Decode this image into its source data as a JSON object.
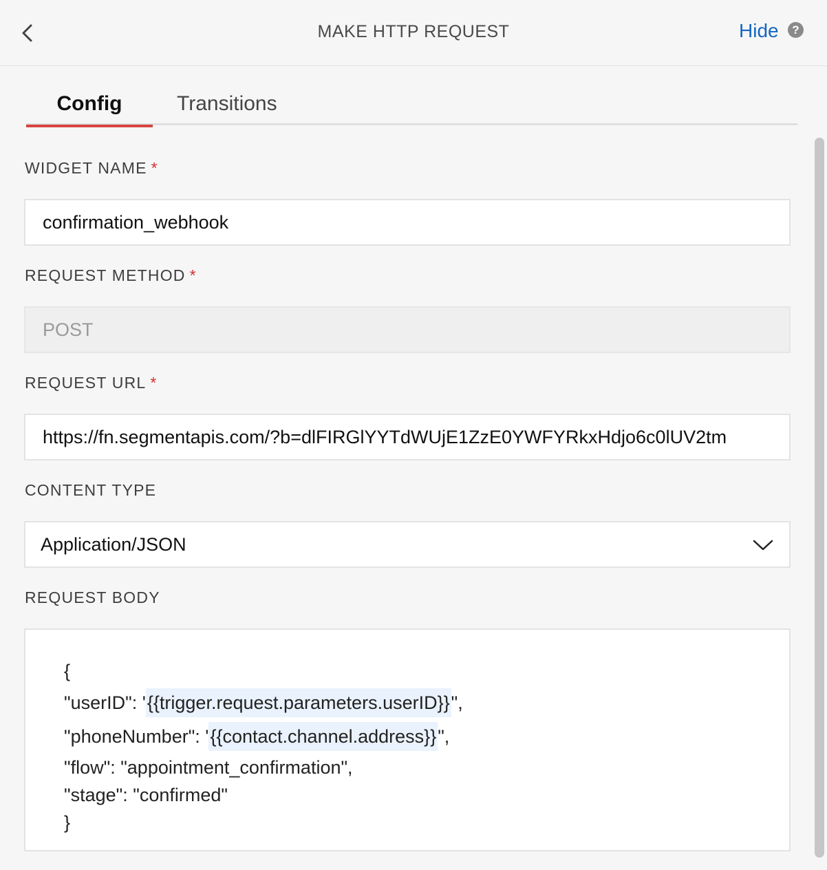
{
  "header": {
    "title": "MAKE HTTP REQUEST",
    "hide_label": "Hide",
    "help_glyph": "?"
  },
  "tabs": [
    {
      "label": "Config",
      "active": true
    },
    {
      "label": "Transitions",
      "active": false
    }
  ],
  "fields": {
    "widget_name": {
      "label": "WIDGET NAME",
      "required": "*",
      "value": "confirmation_webhook"
    },
    "request_method": {
      "label": "REQUEST METHOD",
      "required": "*",
      "value": "POST"
    },
    "request_url": {
      "label": "REQUEST URL",
      "required": "*",
      "value": "https://fn.segmentapis.com/?b=dlFIRGlYYTdWUjE1ZzE0YWFYRkxHdjo6c0lUV2tm"
    },
    "content_type": {
      "label": "CONTENT TYPE",
      "value": "Application/JSON"
    },
    "request_body": {
      "label": "REQUEST BODY",
      "lines": [
        {
          "pre": "{",
          "hl": "",
          "post": ""
        },
        {
          "pre": "\"userID\": '",
          "hl": "{{trigger.request.parameters.userID}}",
          "post": "\","
        },
        {
          "pre": "\"phoneNumber\": '",
          "hl": "{{contact.channel.address}}",
          "post": "\","
        },
        {
          "pre": "\"flow\": \"appointment_confirmation\",",
          "hl": "",
          "post": ""
        },
        {
          "pre": "\"stage\": \"confirmed\"",
          "hl": "",
          "post": ""
        },
        {
          "pre": "}",
          "hl": "",
          "post": ""
        }
      ]
    }
  },
  "colors": {
    "accent_tab": "#d64541",
    "link": "#1565c0",
    "required": "#d32f2f",
    "template_highlight": "#e9f2fd"
  },
  "icons": {
    "back": "chevron-left-icon",
    "help": "question-circle-icon",
    "dropdown": "chevron-down-icon"
  }
}
